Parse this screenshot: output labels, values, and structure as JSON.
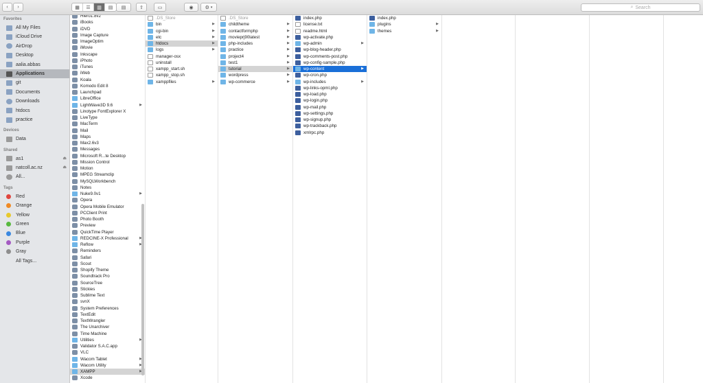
{
  "toolbar": {
    "back": "‹",
    "forward": "›",
    "view_buttons": [
      "▦",
      "☰",
      "▥",
      "▤"
    ],
    "share": "⇪",
    "tag": "▭",
    "eye": "◉",
    "gear": "⚙",
    "search_placeholder": "Search"
  },
  "sidebar": {
    "favorites_header": "Favorites",
    "favorites": [
      "All My Files",
      "iCloud Drive",
      "AirDrop",
      "Desktop",
      "aalia.abbas",
      "Applications",
      "git",
      "Documents",
      "Downloads",
      "htdocs",
      "practice"
    ],
    "devices_header": "Devices",
    "devices": [
      "Data"
    ],
    "shared_header": "Shared",
    "shared": [
      "as1",
      "natcoll.ac.nz",
      "All..."
    ],
    "tags_header": "Tags",
    "tags": [
      {
        "label": "Red",
        "color": "#e0463f"
      },
      {
        "label": "Orange",
        "color": "#f08a24"
      },
      {
        "label": "Yellow",
        "color": "#e8c92c"
      },
      {
        "label": "Green",
        "color": "#58b93f"
      },
      {
        "label": "Blue",
        "color": "#3a88e0"
      },
      {
        "label": "Purple",
        "color": "#a45ac2"
      },
      {
        "label": "Gray",
        "color": "#8e8e8e"
      },
      {
        "label": "All Tags...",
        "color": ""
      }
    ]
  },
  "col1": [
    "Hiero1.8v2",
    "iBooks",
    "iDVD",
    "Image Capture",
    "ImageOptim",
    "iMovie",
    "Inkscape",
    "iPhoto",
    "iTunes",
    "iWeb",
    "Koala",
    "Komodo Edit 8",
    "Launchpad",
    "LibreOffice",
    "LightWave3D 9.6",
    "Linotype FontExplorer X",
    "LiveType",
    "MacTerm",
    "Mail",
    "Maps",
    "Max2.6v3",
    "Messages",
    "Microsoft R...te Desktop",
    "Mission Control",
    "Motion",
    "MPEG Streamclip",
    "MySQLWorkbench",
    "Notes",
    "Nuke9.0v1",
    "Opera",
    "Opera Mobile Emulator",
    "PCClient Print",
    "Photo Booth",
    "Preview",
    "QuickTime Player",
    "REDCINE-X Professional",
    "Reflow",
    "Reminders",
    "Safari",
    "Scout",
    "Shopify Theme",
    "Soundtrack Pro",
    "SourceTree",
    "Stickies",
    "Sublime Text",
    "svnX",
    "System Preferences",
    "TextEdit",
    "TextWrangler",
    "The Unarchiver",
    "Time Machine",
    "Utilities",
    "Validator S.A.C.app",
    "VLC",
    "Wacom Tablet",
    "Wacom Utility",
    "XAMPP",
    "Xcode"
  ],
  "col2": [
    ".DS_Store",
    "bin",
    "cgi-bin",
    "etc",
    "htdocs",
    "logs",
    "manager-osx",
    "uninstall",
    "xampp_start.sh",
    "xampp_stop.sh",
    "xamppfiles"
  ],
  "col3": [
    ".DS_Store",
    "childtheme",
    "contactformphp",
    "movieprj90latest",
    "php-includes",
    "practice",
    "project4",
    "test1",
    "tutorial",
    "wordpress",
    "wp-commerce"
  ],
  "col4": [
    "index.php",
    "license.txt",
    "readme.html",
    "wp-activate.php",
    "wp-admin",
    "wp-blog-header.php",
    "wp-comments-post.php",
    "wp-config-sample.php",
    "wp-content",
    "wp-cron.php",
    "wp-includes",
    "wp-links-opml.php",
    "wp-load.php",
    "wp-login.php",
    "wp-mail.php",
    "wp-settings.php",
    "wp-signup.php",
    "wp-trackback.php",
    "xmlrpc.php"
  ],
  "col5": [
    "index.php",
    "plugins",
    "themes"
  ]
}
